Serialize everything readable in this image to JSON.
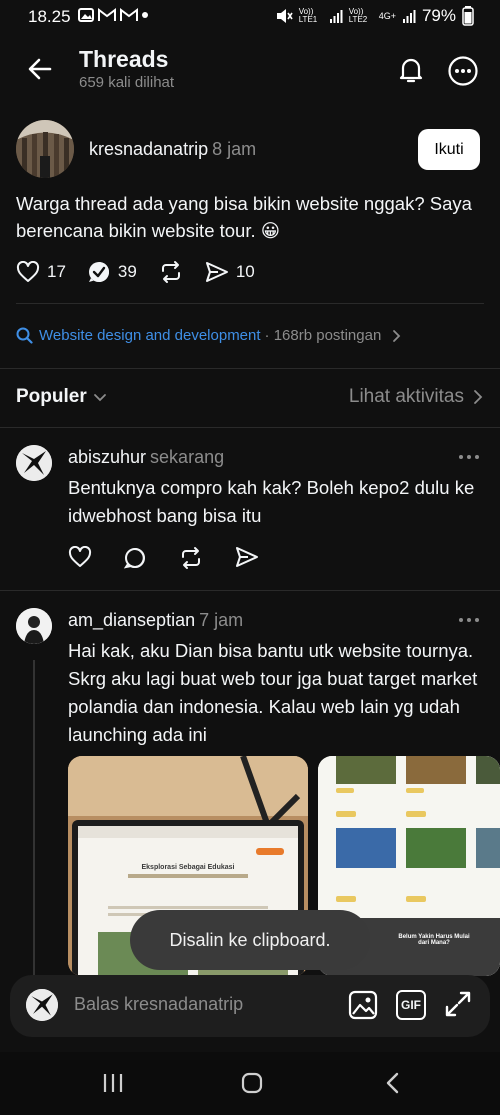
{
  "status_bar": {
    "time": "18.25",
    "battery": "79%",
    "volte1": "Vo)) LTE1",
    "volte2": "Vo)) LTE2",
    "net": "4G+"
  },
  "header": {
    "title": "Threads",
    "views": "659 kali dilihat"
  },
  "post": {
    "username": "kresnadanatrip",
    "time": "8 jam",
    "follow_label": "Ikuti",
    "text": "Warga thread ada yang bisa bikin website nggak? Saya berencana bikin website tour. 😀",
    "likes": "17",
    "replies": "39",
    "shares": "10"
  },
  "topic": {
    "name": "Website design and development",
    "count": "· 168rb postingan"
  },
  "sort": {
    "label": "Populer",
    "activity": "Lihat aktivitas"
  },
  "replies": [
    {
      "username": "abiszuhur",
      "time": "sekarang",
      "text": "Bentuknya compro kah kak? Boleh kepo2 dulu ke idwebhost bang bisa itu"
    },
    {
      "username": "am_dianseptian",
      "time": "7 jam",
      "text": "Hai kak, aku Dian bisa bantu utk website tournya. Skrg aku lagi buat web tour jga buat target market polandia dan indonesia. Kalau web lain yg udah launching ada ini"
    }
  ],
  "website_preview": {
    "headline": "Eksplorasi Sebagai Edukasi",
    "card_title": "Belum Yakin Harus Mulai dari Mana?"
  },
  "toast": "Disalin ke clipboard.",
  "reply_bar": {
    "placeholder": "Balas kresnadanatrip",
    "gif_label": "GIF"
  },
  "colors": {
    "background": "#101010",
    "link": "#3f8fe6",
    "muted": "#8c8c8c"
  }
}
